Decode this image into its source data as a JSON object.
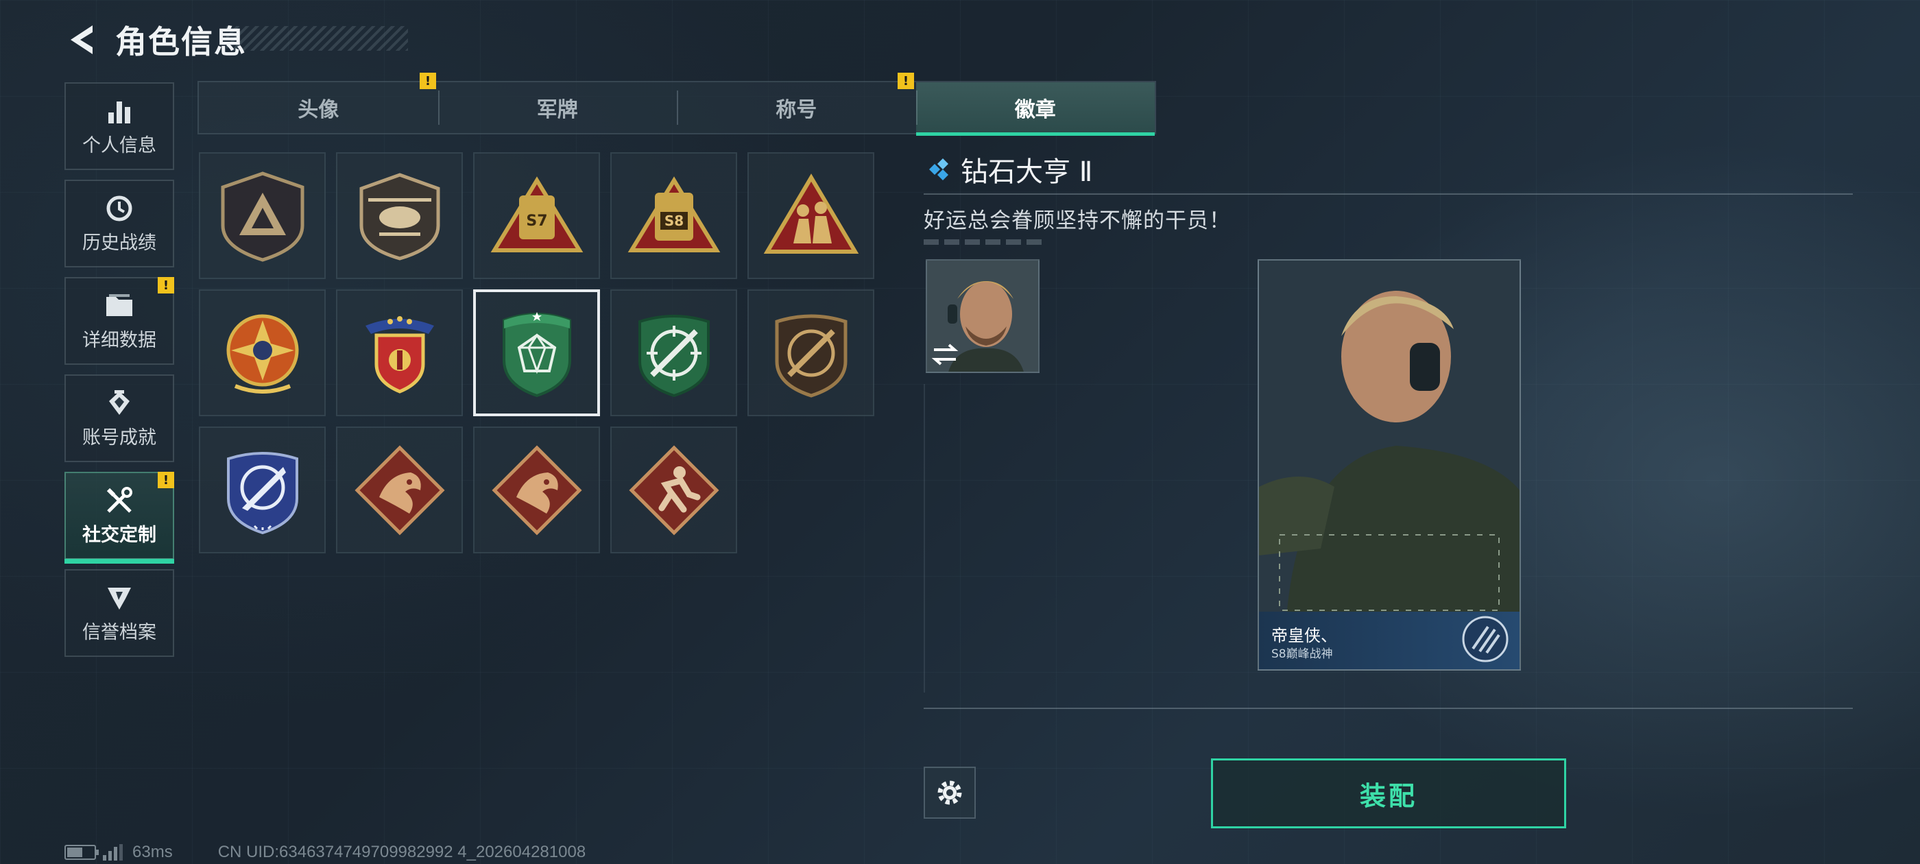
{
  "header": {
    "title": "角色信息",
    "back_icon": "back-arrow-icon"
  },
  "sidebar": {
    "items": [
      {
        "label": "个人信息",
        "icon": "bar-chart-icon",
        "warning": false,
        "active": false
      },
      {
        "label": "历史战绩",
        "icon": "history-icon",
        "warning": false,
        "active": false
      },
      {
        "label": "详细数据",
        "icon": "folder-icon",
        "warning": true,
        "active": false
      },
      {
        "label": "账号成就",
        "icon": "achievement-icon",
        "warning": false,
        "active": false
      },
      {
        "label": "社交定制",
        "icon": "tools-icon",
        "warning": true,
        "active": true
      },
      {
        "label": "信誉档案",
        "icon": "shield-badge-icon",
        "warning": false,
        "active": false
      }
    ]
  },
  "tabs": [
    {
      "label": "头像",
      "warning": true,
      "active": false
    },
    {
      "label": "军牌",
      "warning": false,
      "active": false
    },
    {
      "label": "称号",
      "warning": true,
      "active": false
    },
    {
      "label": "徽章",
      "warning": false,
      "active": true
    }
  ],
  "warning_mark": "!",
  "badges": [
    {
      "name": "badge-triangle-shield",
      "selected": false
    },
    {
      "name": "badge-helicopter",
      "selected": false
    },
    {
      "name": "badge-s7",
      "selected": false,
      "text": "S7"
    },
    {
      "name": "badge-s8",
      "selected": false,
      "text": "S8"
    },
    {
      "name": "badge-soldiers",
      "selected": false
    },
    {
      "name": "badge-star-compass",
      "selected": false
    },
    {
      "name": "badge-winged-shield",
      "selected": false
    },
    {
      "name": "badge-diamond-tycoon",
      "selected": true
    },
    {
      "name": "badge-rifle-green",
      "selected": false
    },
    {
      "name": "badge-rifle-brown",
      "selected": false
    },
    {
      "name": "badge-knife-blue",
      "selected": false
    },
    {
      "name": "badge-dragon-1",
      "selected": false
    },
    {
      "name": "badge-dragon-2",
      "selected": false
    },
    {
      "name": "badge-runner",
      "selected": false
    }
  ],
  "detail": {
    "badge_name": "钻石大亨 Ⅱ",
    "description": "好运总会眷顾坚持不懈的干员！",
    "card": {
      "player_name": "帝皇侠、",
      "subtitle": "S8巅峰战神"
    }
  },
  "actions": {
    "equip_label": "装配",
    "settings_icon": "gear-icon"
  },
  "status_bar": {
    "ping": "63ms",
    "uid": "CN UID:6346374749709982992 4_202604281008"
  },
  "colors": {
    "accent": "#2fd3a4",
    "warning": "#f2c21c",
    "selected_border": "#e8ecef"
  }
}
